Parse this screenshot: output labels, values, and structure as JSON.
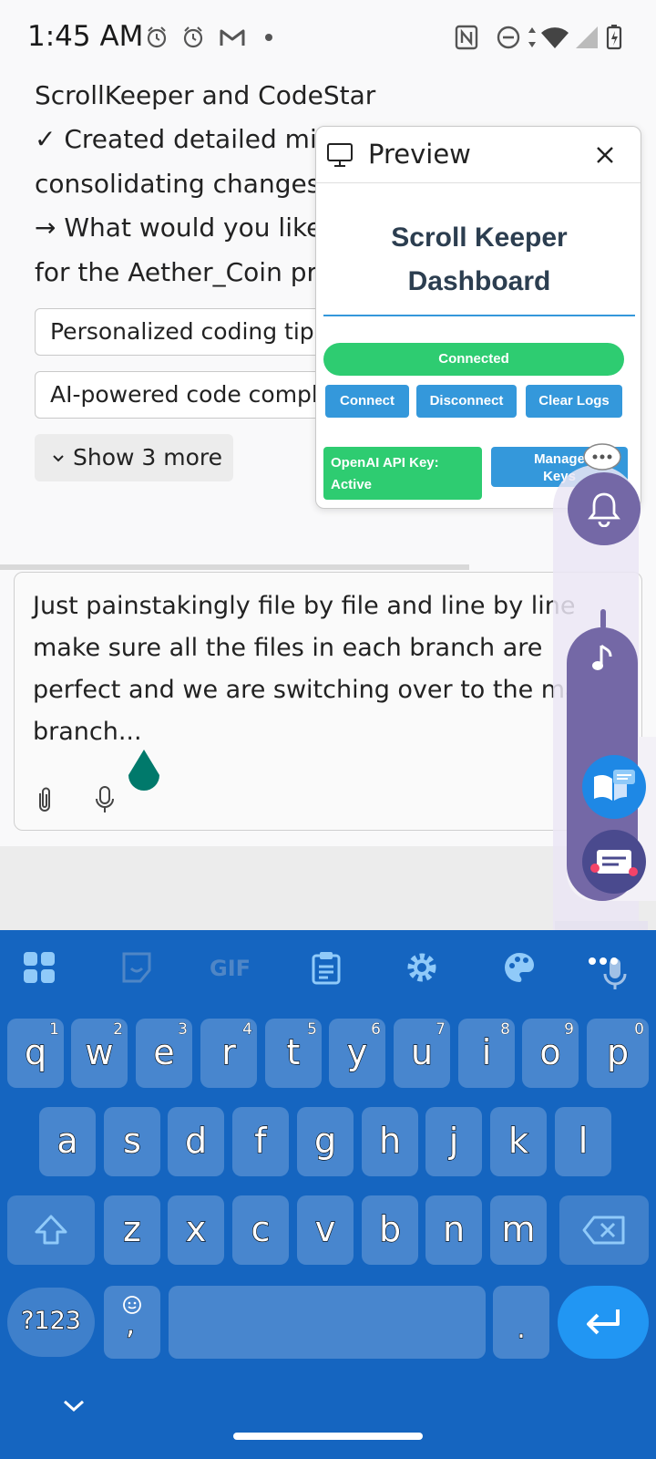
{
  "status_bar": {
    "time": "1:45 AM"
  },
  "chat": {
    "lines": [
      "ScrollKeeper and CodeStar",
      "✓ Created detailed mi",
      "consolidating changes",
      "→ What would you like",
      "for the Aether_Coin pr"
    ],
    "suggestions": [
      "Personalized coding tips",
      "AI-powered code comple"
    ],
    "show_more_label": "Show 3 more"
  },
  "input": {
    "value": "Just painstakingly file by file and line by line make sure all the files in each branch are perfect and we are switching over to the main branch..."
  },
  "preview": {
    "title": "Preview",
    "dashboard_title_line1": "Scroll Keeper",
    "dashboard_title_line2": "Dashboard",
    "connection_status": "Connected",
    "connect_label": "Connect",
    "disconnect_label": "Disconnect",
    "clear_logs_label": "Clear Logs",
    "api_key_status_line1": "OpenAI API Key:",
    "api_key_status_line2": "Active",
    "manage_keys_line1": "Manage",
    "manage_keys_line2": "Keys"
  },
  "keyboard": {
    "toolbar": [
      "apps-icon",
      "sticker-icon",
      "gif-icon",
      "clipboard-icon",
      "settings-icon",
      "palette-icon",
      "more-icon"
    ],
    "gif_label": "GIF",
    "row1": [
      {
        "ch": "q",
        "hint": "1"
      },
      {
        "ch": "w",
        "hint": "2"
      },
      {
        "ch": "e",
        "hint": "3"
      },
      {
        "ch": "r",
        "hint": "4"
      },
      {
        "ch": "t",
        "hint": "5"
      },
      {
        "ch": "y",
        "hint": "6"
      },
      {
        "ch": "u",
        "hint": "7"
      },
      {
        "ch": "i",
        "hint": "8"
      },
      {
        "ch": "o",
        "hint": "9"
      },
      {
        "ch": "p",
        "hint": "0"
      }
    ],
    "row2": [
      "a",
      "s",
      "d",
      "f",
      "g",
      "h",
      "j",
      "k",
      "l"
    ],
    "row3": [
      "z",
      "x",
      "c",
      "v",
      "b",
      "n",
      "m"
    ],
    "symbols_label": "?123",
    "comma_label": ",",
    "period_label": "."
  },
  "colors": {
    "keyboard_bg": "#1565c0",
    "enter_bg": "#2196f3",
    "connected_green": "#2ecc71",
    "button_blue": "#3498db",
    "dashboard_title": "#2c3e50"
  }
}
